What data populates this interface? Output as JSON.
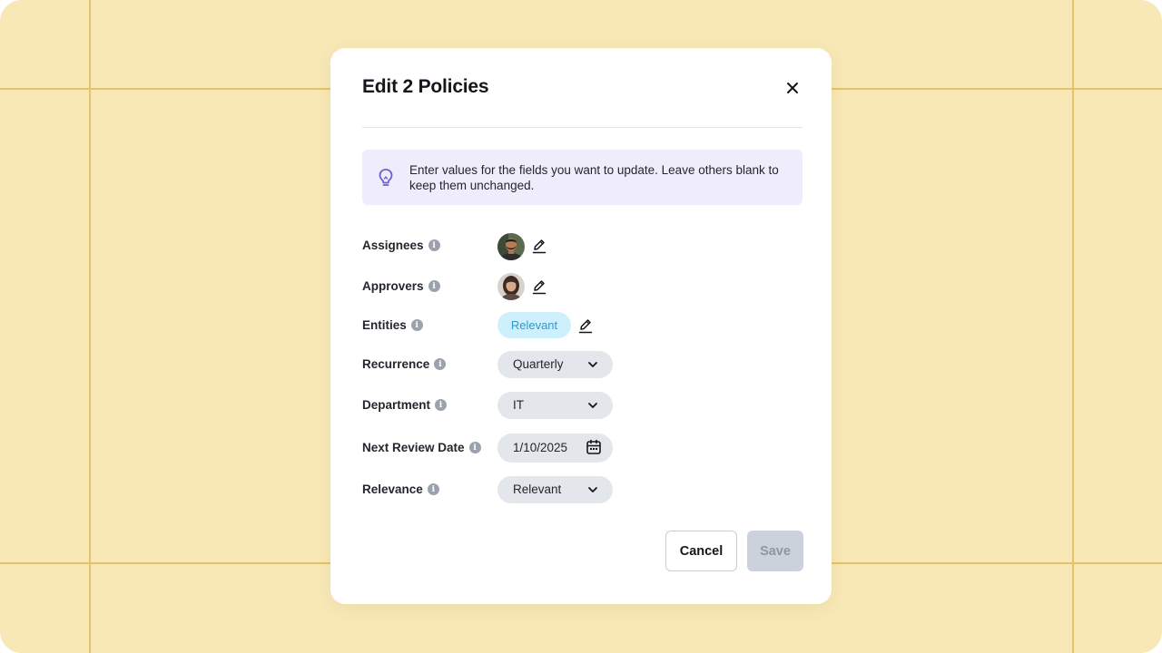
{
  "modal": {
    "title": "Edit 2 Policies",
    "close_icon": "close-icon"
  },
  "banner": {
    "icon": "lightbulb-icon",
    "text": "Enter values for the fields you want to update. Leave others blank to keep them unchanged.",
    "background": "#efedfb",
    "icon_color": "#6c5fcf"
  },
  "fields": {
    "assignees": {
      "label": "Assignees",
      "avatar": "male-user-avatar",
      "edit_icon": "pencil-icon"
    },
    "approvers": {
      "label": "Approvers",
      "avatar": "female-user-avatar",
      "edit_icon": "pencil-icon"
    },
    "entities": {
      "label": "Entities",
      "chip": "Relevant",
      "edit_icon": "pencil-icon"
    },
    "recurrence": {
      "label": "Recurrence",
      "value": "Quarterly",
      "icon": "chevron-down-icon"
    },
    "department": {
      "label": "Department",
      "value": "IT",
      "icon": "chevron-down-icon"
    },
    "next_review_date": {
      "label": "Next Review Date",
      "value": "1/10/2025",
      "icon": "calendar-icon"
    },
    "relevance": {
      "label": "Relevance",
      "value": "Relevant",
      "icon": "chevron-down-icon"
    }
  },
  "footer": {
    "cancel_label": "Cancel",
    "save_label": "Save"
  },
  "colors": {
    "background": "#f7e8b5",
    "grid": "#e3c46a",
    "chip_bg": "#cdf0fc",
    "chip_text": "#3896c9",
    "select_bg": "#e3e6ea",
    "save_disabled_bg": "#ccd2dc"
  }
}
